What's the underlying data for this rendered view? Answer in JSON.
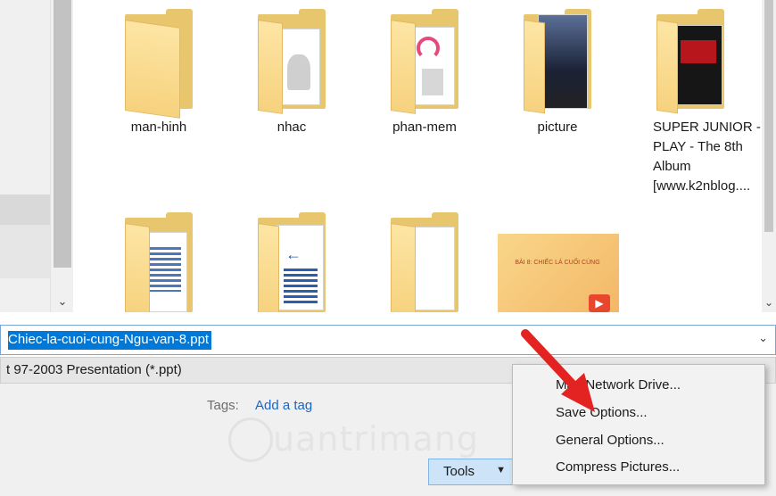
{
  "files": [
    {
      "label": "man-hinh"
    },
    {
      "label": "nhac"
    },
    {
      "label": "phan-mem"
    },
    {
      "label": "picture"
    },
    {
      "label": "SUPER JUNIOR - PLAY - The 8th Album [www.k2nblog...."
    },
    {
      "label": ""
    },
    {
      "label": ""
    },
    {
      "label": ""
    }
  ],
  "thumbnail": {
    "text": "BÀI 8: CHIẾC LÁ CUỐI CÙNG"
  },
  "filename": {
    "value": "Chiec-la-cuoi-cung-Ngu-van-8.ppt"
  },
  "save_type": {
    "value": "t 97-2003 Presentation (*.ppt)"
  },
  "tags": {
    "label": "Tags:",
    "link": "Add a tag"
  },
  "watermark": {
    "text": "uantrimang"
  },
  "tools_button": {
    "label": "Tools"
  },
  "context_menu": {
    "items": [
      {
        "label": "Map Network Drive..."
      },
      {
        "label": "Save Options..."
      },
      {
        "label": "General Options..."
      },
      {
        "label": "Compress Pictures..."
      }
    ]
  },
  "colors": {
    "accent": "#0078d7",
    "folder": "#f6d27e",
    "link": "#1a66c7",
    "arrow": "#e32222"
  },
  "icons": {
    "folder": "folder-icon",
    "dropdown": "chevron-down-icon",
    "arrow": "red-pointer-arrow"
  }
}
